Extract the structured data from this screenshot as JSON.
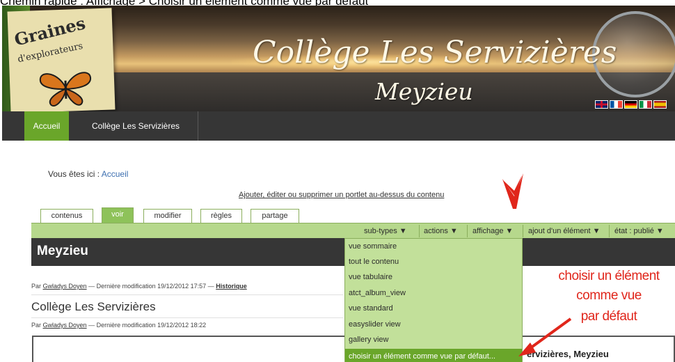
{
  "caption": "Chemin rapide : Affichage > Choisir un élément comme vue par défaut",
  "banner": {
    "logo_line1": "Graines",
    "logo_line2": "d'explorateurs",
    "title": "Collège Les Servizières",
    "subtitle": "Meyzieu",
    "flags": [
      "flag-uk",
      "flag-france",
      "flag-germany",
      "flag-italy",
      "flag-spain"
    ]
  },
  "nav": {
    "items": [
      {
        "label": "Accueil",
        "active": true
      },
      {
        "label": "Collège Les Servizières",
        "active": false
      }
    ]
  },
  "breadcrumb": {
    "prefix": "Vous êtes ici :",
    "link": "Accueil"
  },
  "portlet_link": "Ajouter, éditer ou supprimer un portlet au-dessus du contenu",
  "tabs": [
    {
      "label": "contenus",
      "active": false
    },
    {
      "label": "voir",
      "active": true
    },
    {
      "label": "modifier",
      "active": false
    },
    {
      "label": "règles",
      "active": false
    },
    {
      "label": "partage",
      "active": false
    }
  ],
  "actions": {
    "subtypes": "sub-types ▼",
    "actions": "actions ▼",
    "affichage": "affichage ▼",
    "ajout": "ajout d'un élément ▼",
    "etat": "état : publié ▼"
  },
  "heading": "Meyzieu",
  "dropdown": {
    "items": [
      "vue sommaire",
      "tout le contenu",
      "vue tabulaire",
      "atct_album_view",
      "vue standard",
      "easyslider view",
      "gallery view",
      "choisir un élément comme vue par défaut..."
    ],
    "highlighted_index": 7
  },
  "byline1": {
    "par": "Par",
    "author": "Gwladys Doyen",
    "modified": "— Dernière modification 19/12/2012 17:57 —",
    "history": "Historique"
  },
  "college_title": "Collège Les Servizières",
  "byline2": {
    "par": "Par",
    "author": "Gwladys Doyen",
    "modified": "— Dernière modification 19/12/2012 18:22"
  },
  "box_text": "ervizières, Meyzieu",
  "annotation": {
    "line1": "choisir un élément",
    "line2": "comme vue",
    "line3": "par défaut"
  },
  "colors": {
    "nav_active": "#6aa62a",
    "actionbar": "#b6d88c",
    "dropdown_bg": "#c2e09a",
    "annotation_red": "#e0261b",
    "dark_bar": "#363636"
  }
}
